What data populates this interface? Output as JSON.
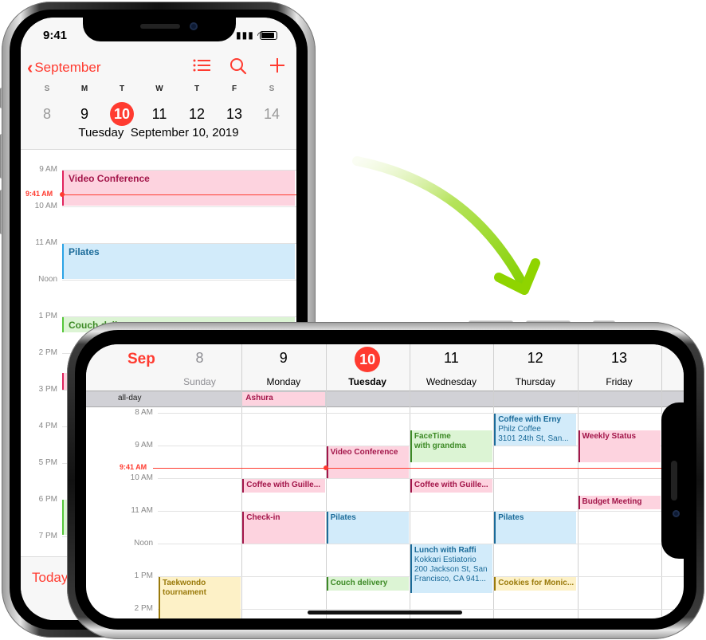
{
  "portrait": {
    "status": {
      "time": "9:41"
    },
    "toolbar": {
      "back_label": "September",
      "back_icon": "chevron-left-icon",
      "list_icon": "list-icon",
      "search_icon": "search-icon",
      "add_icon": "plus-icon"
    },
    "week": {
      "letters": [
        "S",
        "M",
        "T",
        "W",
        "T",
        "F",
        "S"
      ],
      "days": [
        "8",
        "9",
        "10",
        "11",
        "12",
        "13",
        "14"
      ],
      "selected_index": 2
    },
    "subtitle": {
      "weekday": "Tuesday",
      "date": "September 10, 2019"
    },
    "hours": [
      "9 AM",
      "10 AM",
      "11 AM",
      "Noon",
      "1 PM",
      "2 PM",
      "3 PM",
      "4 PM",
      "5 PM",
      "6 PM",
      "7 PM"
    ],
    "now_label": "9:41 AM",
    "events": [
      {
        "title": "Video Conference",
        "color": "pink"
      },
      {
        "title": "Pilates",
        "color": "blue"
      },
      {
        "title": "Couch delivery",
        "color": "green"
      }
    ],
    "today_label": "Today"
  },
  "landscape": {
    "month": "Sep",
    "days": [
      {
        "num": "8",
        "name": "Sunday",
        "dim": true
      },
      {
        "num": "9",
        "name": "Monday"
      },
      {
        "num": "10",
        "name": "Tuesday",
        "today": true
      },
      {
        "num": "11",
        "name": "Wednesday"
      },
      {
        "num": "12",
        "name": "Thursday"
      },
      {
        "num": "13",
        "name": "Friday"
      }
    ],
    "allday_label": "all-day",
    "allday_events": [
      {
        "day": 1,
        "title": "Ashura",
        "color": "pink"
      }
    ],
    "hours": [
      "8 AM",
      "9 AM",
      "10 AM",
      "11 AM",
      "Noon",
      "1 PM",
      "2 PM"
    ],
    "now_label": "9:41 AM",
    "events": [
      {
        "day": 2,
        "title": "Video Conference",
        "color": "pink"
      },
      {
        "day": 3,
        "title": "FaceTime",
        "line2": "with grandma",
        "color": "green"
      },
      {
        "day": 4,
        "title": "Coffee with Erny",
        "line2": "Philz Coffee",
        "line3": "3101 24th St, San...",
        "color": "blue"
      },
      {
        "day": 5,
        "title": "Weekly Status",
        "color": "pink"
      },
      {
        "day": 1,
        "title": "Coffee with Guille...",
        "color": "pink"
      },
      {
        "day": 3,
        "title": "Coffee with Guille...",
        "color": "pink"
      },
      {
        "day": 5,
        "title": "Budget Meeting",
        "color": "pink"
      },
      {
        "day": 1,
        "title": "Check-in",
        "color": "pink"
      },
      {
        "day": 2,
        "title": "Pilates",
        "color": "blue"
      },
      {
        "day": 4,
        "title": "Pilates",
        "color": "blue"
      },
      {
        "day": 3,
        "title": "Lunch with Raffi",
        "line2": "Kokkari Estiatorio",
        "line3": "200 Jackson St, San",
        "line4": "Francisco, CA  941...",
        "color": "blue"
      },
      {
        "day": 0,
        "title": "Taekwondo",
        "line2": "tournament",
        "color": "yellow"
      },
      {
        "day": 2,
        "title": "Couch delivery",
        "color": "green"
      },
      {
        "day": 4,
        "title": "Cookies for Monic...",
        "color": "yellow"
      }
    ]
  },
  "colors": {
    "accent": "#ff3b30",
    "arrow": "#8fd400",
    "pink": "#fdd3df",
    "blue": "#d2ebfa",
    "green": "#dcf4d4",
    "yellow": "#fdf1c7"
  }
}
